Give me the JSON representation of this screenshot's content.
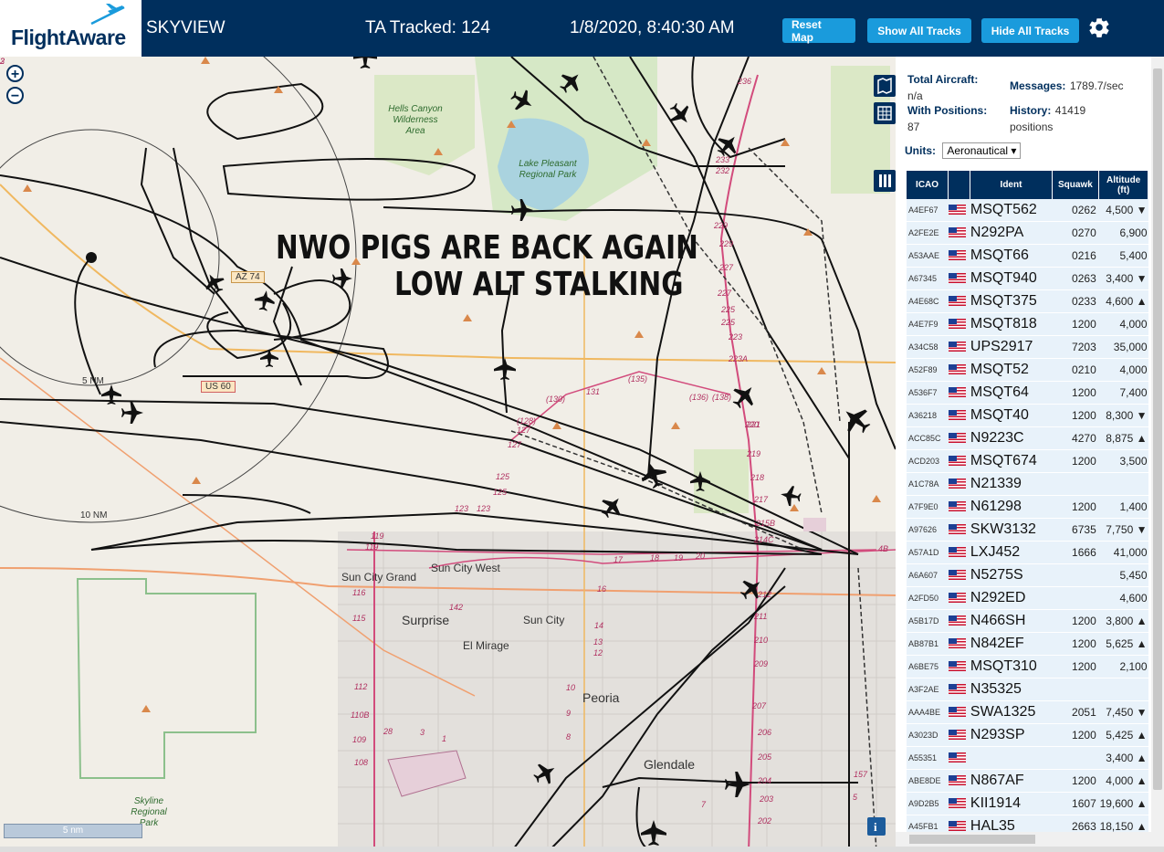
{
  "header": {
    "logo": "FlightAware",
    "app_title": "SKYVIEW",
    "tracked": "TA Tracked: 124",
    "datetime": "1/8/2020, 8:40:30 AM",
    "buttons": {
      "reset_map": "Reset Map",
      "show_all": "Show All Tracks",
      "hide_all": "Hide All Tracks"
    }
  },
  "map": {
    "zoom_in": "+",
    "zoom_out": "−",
    "overlay_line1": "NWO PIGS ARE BACK AGAIN",
    "overlay_line2": "LOW ALT STALKING",
    "scale": "5 nm",
    "range_rings": [
      "5 NM",
      "10 NM"
    ],
    "places": [
      "Sun City Grand",
      "Sun City West",
      "Surprise",
      "Sun City",
      "El Mirage",
      "Peoria",
      "Glendale"
    ],
    "parks": {
      "hells_canyon": "Hells Canyon Wilderness Area",
      "lake_pleasant": "Lake Pleasant Regional Park",
      "skyline": "Skyline Regional Park"
    },
    "road_shields": [
      "AZ 74",
      "US 60"
    ],
    "route_labels": [
      "236",
      "233",
      "232",
      "229",
      "229",
      "227",
      "227",
      "225",
      "225",
      "223",
      "223A",
      "(138)",
      "(136)",
      "(135)",
      "131",
      "(130)",
      "(128)",
      "127",
      "127",
      "125",
      "125",
      "123",
      "123",
      "219",
      "218",
      "217",
      "215B",
      "214C",
      "212",
      "211",
      "210",
      "209",
      "207",
      "206",
      "205",
      "204",
      "203",
      "202",
      "221",
      "220",
      "119",
      "119",
      "116",
      "115",
      "112",
      "110B",
      "109",
      "108",
      "142",
      "17",
      "16",
      "18",
      "19",
      "20",
      "14",
      "13",
      "12",
      "10",
      "9",
      "8",
      "7",
      "157",
      "5",
      "4B",
      "3",
      "28",
      "1",
      "2",
      "3"
    ]
  },
  "panel": {
    "total_aircraft_label": "Total Aircraft:",
    "total_aircraft_value": "n/a",
    "messages_label": "Messages:",
    "messages_value": "1789.7/sec",
    "with_positions_label": "With Positions:",
    "with_positions_value": "87",
    "history_label": "History:",
    "history_value": "41419",
    "history_unit": "positions",
    "units_label": "Units:",
    "units_value": "Aeronautical",
    "columns": {
      "icao": "ICAO",
      "flag": "",
      "ident": "Ident",
      "squawk": "Squawk",
      "altitude": "Altitude (ft)"
    },
    "rows": [
      {
        "icao": "A4EF67",
        "ident": "MSQT562",
        "squawk": "0262",
        "alt": "4,500 ▼"
      },
      {
        "icao": "A2FE2E",
        "ident": "N292PA",
        "squawk": "0270",
        "alt": "6,900"
      },
      {
        "icao": "A53AAE",
        "ident": "MSQT66",
        "squawk": "0216",
        "alt": "5,400"
      },
      {
        "icao": "A67345",
        "ident": "MSQT940",
        "squawk": "0263",
        "alt": "3,400 ▼"
      },
      {
        "icao": "A4E68C",
        "ident": "MSQT375",
        "squawk": "0233",
        "alt": "4,600 ▲"
      },
      {
        "icao": "A4E7F9",
        "ident": "MSQT818",
        "squawk": "1200",
        "alt": "4,000"
      },
      {
        "icao": "A34C58",
        "ident": "UPS2917",
        "squawk": "7203",
        "alt": "35,000"
      },
      {
        "icao": "A52F89",
        "ident": "MSQT52",
        "squawk": "0210",
        "alt": "4,000"
      },
      {
        "icao": "A536F7",
        "ident": "MSQT64",
        "squawk": "1200",
        "alt": "7,400"
      },
      {
        "icao": "A36218",
        "ident": "MSQT40",
        "squawk": "1200",
        "alt": "8,300 ▼"
      },
      {
        "icao": "ACC85C",
        "ident": "N9223C",
        "squawk": "4270",
        "alt": "8,875 ▲"
      },
      {
        "icao": "ACD203",
        "ident": "MSQT674",
        "squawk": "1200",
        "alt": "3,500"
      },
      {
        "icao": "A1C78A",
        "ident": "N21339",
        "squawk": "",
        "alt": ""
      },
      {
        "icao": "A7F9E0",
        "ident": "N61298",
        "squawk": "1200",
        "alt": "1,400"
      },
      {
        "icao": "A97626",
        "ident": "SKW3132",
        "squawk": "6735",
        "alt": "7,750 ▼"
      },
      {
        "icao": "A57A1D",
        "ident": "LXJ452",
        "squawk": "1666",
        "alt": "41,000"
      },
      {
        "icao": "A6A607",
        "ident": "N5275S",
        "squawk": "",
        "alt": "5,450"
      },
      {
        "icao": "A2FD50",
        "ident": "N292ED",
        "squawk": "",
        "alt": "4,600"
      },
      {
        "icao": "A5B17D",
        "ident": "N466SH",
        "squawk": "1200",
        "alt": "3,800 ▲"
      },
      {
        "icao": "AB87B1",
        "ident": "N842EF",
        "squawk": "1200",
        "alt": "5,625 ▲"
      },
      {
        "icao": "A6BE75",
        "ident": "MSQT310",
        "squawk": "1200",
        "alt": "2,100"
      },
      {
        "icao": "A3F2AE",
        "ident": "N35325",
        "squawk": "",
        "alt": ""
      },
      {
        "icao": "AAA4BE",
        "ident": "SWA1325",
        "squawk": "2051",
        "alt": "7,450 ▼"
      },
      {
        "icao": "A3023D",
        "ident": "N293SP",
        "squawk": "1200",
        "alt": "5,425 ▲"
      },
      {
        "icao": "A55351",
        "ident": "",
        "squawk": "",
        "alt": "3,400 ▲"
      },
      {
        "icao": "ABE8DE",
        "ident": "N867AF",
        "squawk": "1200",
        "alt": "4,000 ▲"
      },
      {
        "icao": "A9D2B5",
        "ident": "KII1914",
        "squawk": "1607",
        "alt": "19,600 ▲"
      },
      {
        "icao": "A45FB1",
        "ident": "HAL35",
        "squawk": "2663",
        "alt": "18,150 ▲"
      }
    ]
  },
  "colors": {
    "navy": "#002f5d",
    "button_blue": "#1a9bdc",
    "row_bg": "#e8f2fa",
    "route_red": "#c33d6c",
    "park_green": "#cfe3b8",
    "lake_blue": "#aad3df"
  }
}
